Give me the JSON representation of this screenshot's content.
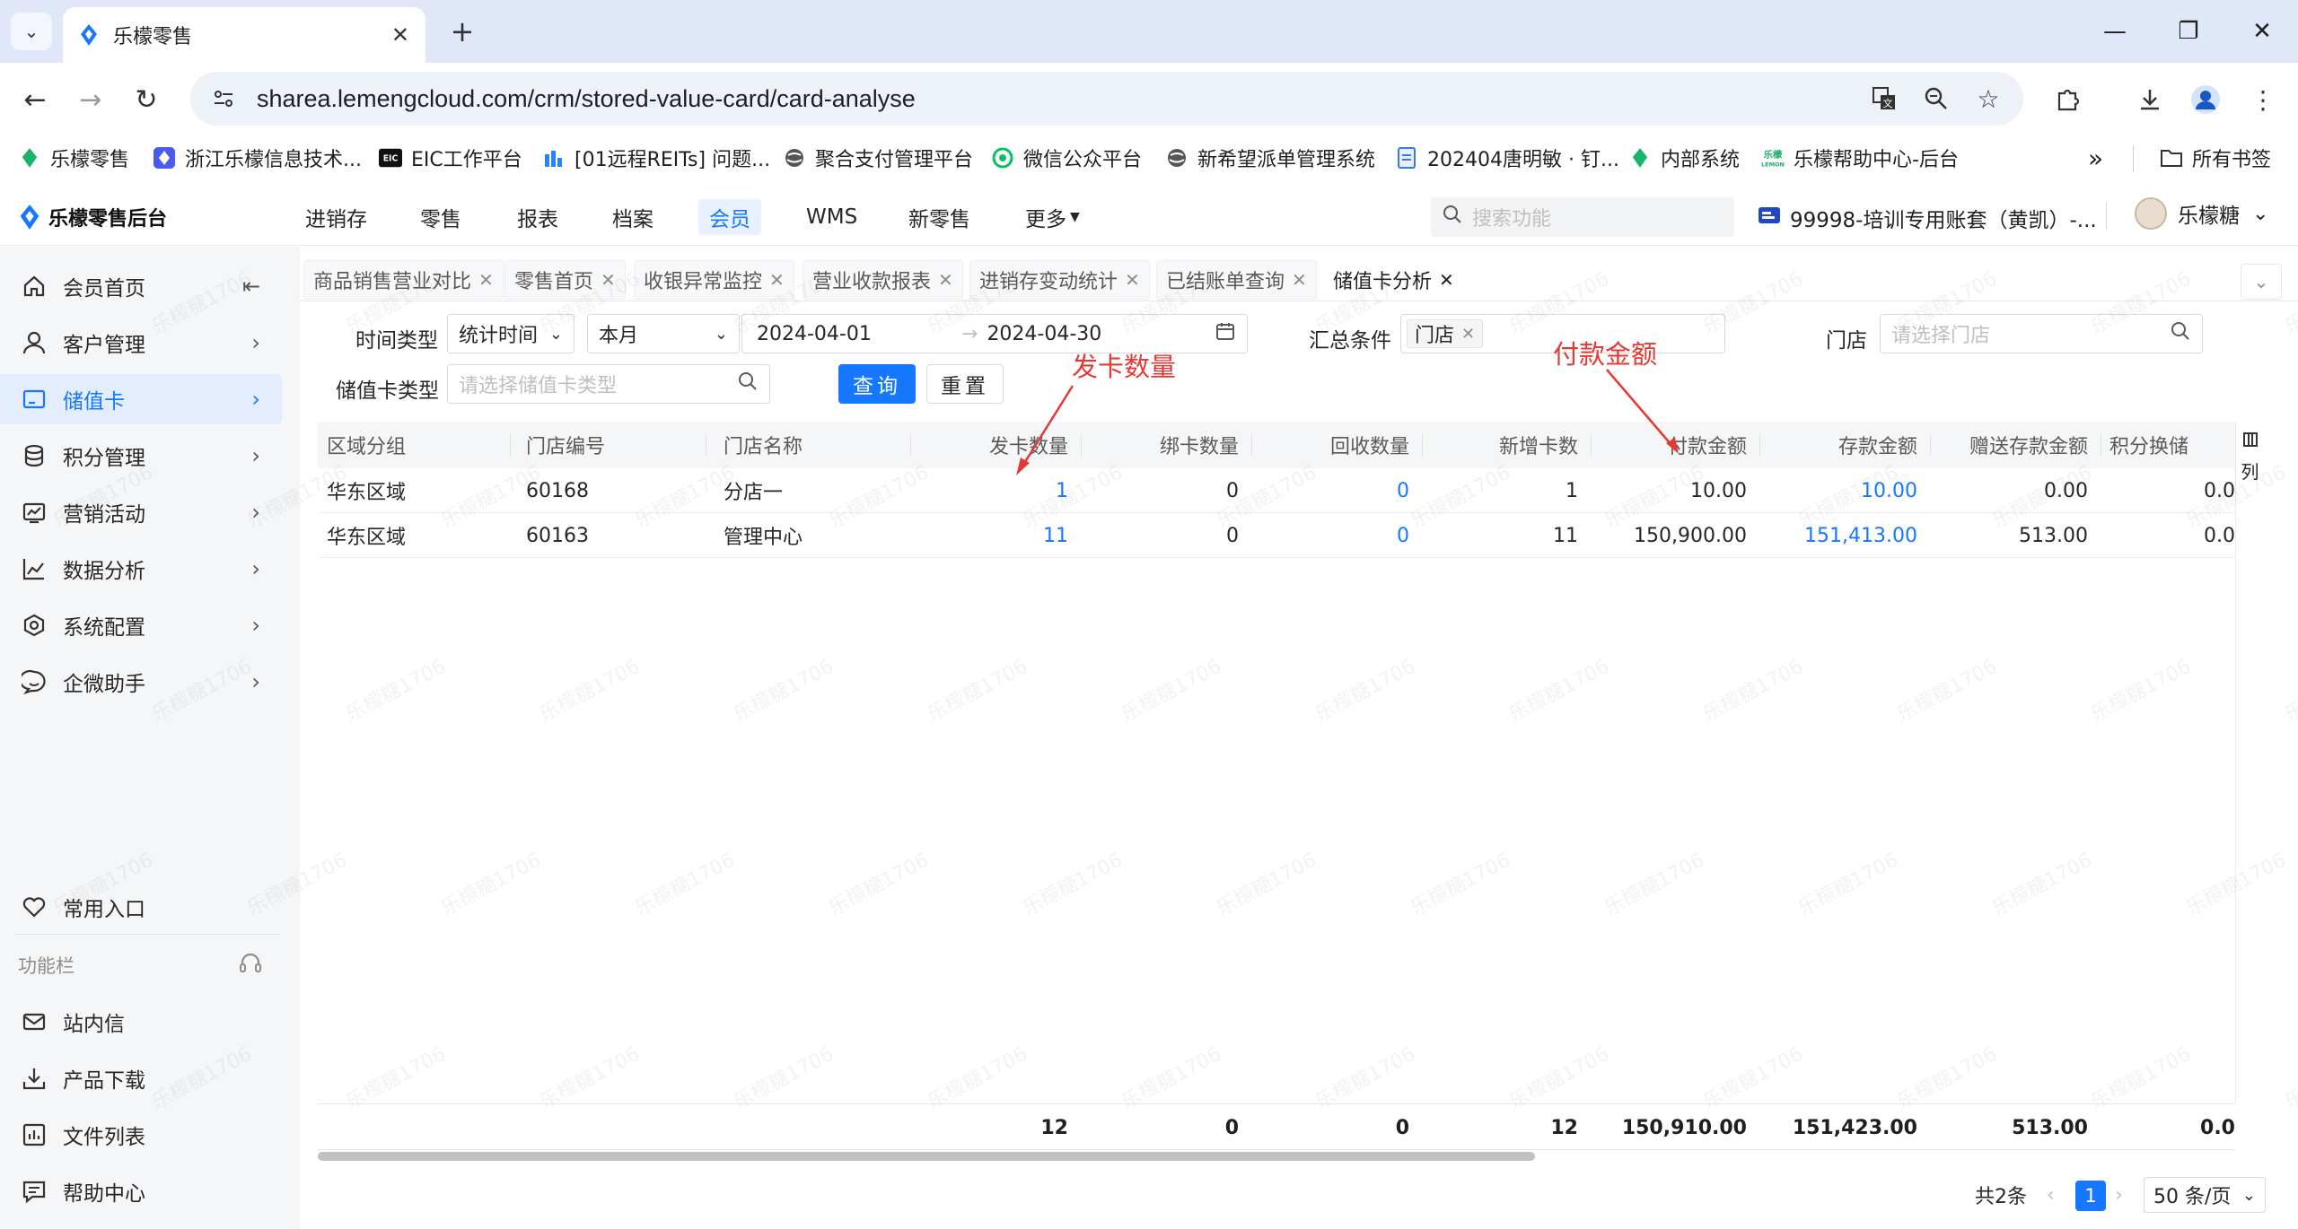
{
  "browser": {
    "tab_title": "乐檬零售",
    "url": "sharea.lemengcloud.com/crm/stored-value-card/card-analyse",
    "bookmarks": [
      {
        "label": "乐檬零售",
        "icon": "lemeng-logo-icon"
      },
      {
        "label": "浙江乐檬信息技术...",
        "icon": "lemeng-blue-icon"
      },
      {
        "label": "EIC工作平台",
        "icon": "eic-icon"
      },
      {
        "label": "[01远程REITs] 问题...",
        "icon": "jira-icon"
      },
      {
        "label": "聚合支付管理平台",
        "icon": "globe-icon"
      },
      {
        "label": "微信公众平台",
        "icon": "wechat-icon"
      },
      {
        "label": "新希望派单管理系统",
        "icon": "globe-icon"
      },
      {
        "label": "202404唐明敏 · 钉...",
        "icon": "doc-icon"
      },
      {
        "label": "内部系统",
        "icon": "lemeng-logo-icon"
      },
      {
        "label": "乐檬帮助中心-后台",
        "icon": "lemeng-help-icon"
      }
    ],
    "all_bookmarks": "所有书签",
    "more": "»"
  },
  "app": {
    "logo_text": "乐檬零售后台",
    "nav": [
      "进销存",
      "零售",
      "报表",
      "档案",
      "会员",
      "WMS",
      "新零售",
      "更多"
    ],
    "active_nav": "会员",
    "search_placeholder": "搜索功能",
    "account": "99998-培训专用账套（黄凯）-...",
    "user": "乐檬糖"
  },
  "sidebar": {
    "items": [
      {
        "label": "会员首页",
        "icon": "home-icon"
      },
      {
        "label": "客户管理",
        "icon": "user-icon"
      },
      {
        "label": "储值卡",
        "icon": "card-icon"
      },
      {
        "label": "积分管理",
        "icon": "database-icon"
      },
      {
        "label": "营销活动",
        "icon": "campaign-icon"
      },
      {
        "label": "数据分析",
        "icon": "chart-icon"
      },
      {
        "label": "系统配置",
        "icon": "settings-icon"
      },
      {
        "label": "企微助手",
        "icon": "chat-icon"
      }
    ],
    "favorite": "常用入口",
    "section_label": "功能栏",
    "bottom_items": [
      {
        "label": "站内信",
        "icon": "mail-icon"
      },
      {
        "label": "产品下载",
        "icon": "download-icon"
      },
      {
        "label": "文件列表",
        "icon": "file-list-icon"
      },
      {
        "label": "帮助中心",
        "icon": "help-icon"
      }
    ]
  },
  "page_tabs": [
    "商品销售营业对比",
    "零售首页",
    "收银异常监控",
    "营业收款报表",
    "进销存变动统计",
    "已结账单查询",
    "储值卡分析"
  ],
  "filters": {
    "time_type_label": "时间类型",
    "time_type_value": "统计时间",
    "period_value": "本月",
    "date_start": "2024-04-01",
    "date_end": "2024-04-30",
    "date_sep": "→",
    "group_label": "汇总条件",
    "group_tag": "门店",
    "store_label": "门店",
    "store_placeholder": "请选择门店",
    "card_type_label": "储值卡类型",
    "card_type_placeholder": "请选择储值卡类型",
    "query_btn": "查询",
    "reset_btn": "重置"
  },
  "table": {
    "columns": [
      "区域分组",
      "门店编号",
      "门店名称",
      "发卡数量",
      "绑卡数量",
      "回收数量",
      "新增卡数",
      "付款金额",
      "存款金额",
      "赠送存款金额",
      "积分换储"
    ],
    "rows": [
      [
        "华东区域",
        "60168",
        "分店一",
        "1",
        "0",
        "0",
        "1",
        "10.00",
        "10.00",
        "0.00",
        "0.0"
      ],
      [
        "华东区域",
        "60163",
        "管理中心",
        "11",
        "0",
        "0",
        "11",
        "150,900.00",
        "151,413.00",
        "513.00",
        "0.0"
      ]
    ],
    "totals": [
      "12",
      "0",
      "0",
      "12",
      "150,910.00",
      "151,423.00",
      "513.00",
      "0.0"
    ],
    "column_setting": "列"
  },
  "pagination": {
    "total": "共2条",
    "current": "1",
    "page_size": "50 条/页"
  },
  "annotations": {
    "card_count": "发卡数量",
    "payment_amount": "付款金额"
  },
  "watermark": "乐檬糖1706",
  "colors": {
    "primary": "#1677ff",
    "annotation": "#e53935"
  }
}
